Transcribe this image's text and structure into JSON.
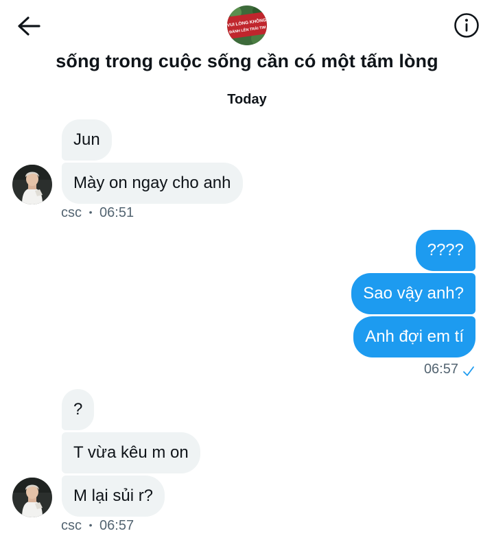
{
  "header": {
    "title": "sống trong cuộc sống cần có một tấm lòng",
    "avatar_text_line1": "VUI LÒNG KHÔNG",
    "avatar_text_line2": "ĐÁNH LÊN TRÀI TIM",
    "back_icon": "arrow-left-icon",
    "info_icon": "info-circle-icon"
  },
  "divider": {
    "label": "Today"
  },
  "messages": [
    {
      "text": "Jun"
    },
    {
      "text": "Mày on ngay cho anh"
    },
    {
      "text": "????"
    },
    {
      "text": "Sao vậy anh?"
    },
    {
      "text": "Anh đợi em tí"
    },
    {
      "text": "?"
    },
    {
      "text": "T vừa kêu m on"
    },
    {
      "text": "M lại sủi r?"
    }
  ],
  "meta": {
    "group1_sender": "csc",
    "group1_sep": "•",
    "group1_time": "06:51",
    "group2_time": "06:57",
    "group3_sender": "csc",
    "group3_sep": "•",
    "group3_time": "06:57"
  },
  "colors": {
    "accent": "#1d9bf0",
    "incoming_bubble": "#eff3f4",
    "meta_text": "#536471",
    "avatar_banner": "#c0262d"
  }
}
